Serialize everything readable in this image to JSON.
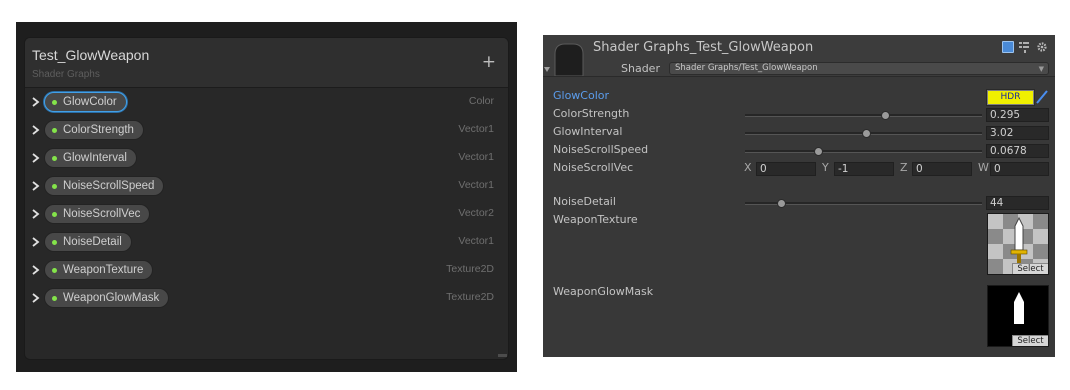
{
  "blackboard": {
    "title": "Test_GlowWeapon",
    "subtitle": "Shader Graphs",
    "add_label": "+",
    "properties": [
      {
        "name": "GlowColor",
        "type": "Color",
        "selected": true
      },
      {
        "name": "ColorStrength",
        "type": "Vector1"
      },
      {
        "name": "GlowInterval",
        "type": "Vector1"
      },
      {
        "name": "NoiseScrollSpeed",
        "type": "Vector1"
      },
      {
        "name": "NoiseScrollVec",
        "type": "Vector2"
      },
      {
        "name": "NoiseDetail",
        "type": "Vector1"
      },
      {
        "name": "WeaponTexture",
        "type": "Texture2D"
      },
      {
        "name": "WeaponGlowMask",
        "type": "Texture2D"
      }
    ],
    "colors": {
      "exposed_dot": "#84e44a",
      "selection": "#44a0e6"
    }
  },
  "inspector": {
    "title": "Shader Graphs_Test_GlowWeapon",
    "shader_label": "Shader",
    "shader_value": "Shader Graphs/Test_GlowWeapon",
    "header_icons": [
      "help-book-icon",
      "layout-icon",
      "gear-icon"
    ],
    "glow_color": {
      "label": "GlowColor",
      "swatch": "#f0f000",
      "badge": "HDR"
    },
    "color_strength": {
      "label": "ColorStrength",
      "value": "0.295",
      "slider": 0.59
    },
    "glow_interval": {
      "label": "GlowInterval",
      "value": "3.02",
      "slider": 0.51
    },
    "noise_scroll_speed": {
      "label": "NoiseScrollSpeed",
      "value": "0.0678",
      "slider": 0.31
    },
    "noise_scroll_vec": {
      "label": "NoiseScrollVec",
      "x_label": "X",
      "x": "0",
      "y_label": "Y",
      "y": "-1",
      "z_label": "Z",
      "z": "0",
      "w_label": "W",
      "w": "0"
    },
    "noise_detail": {
      "label": "NoiseDetail",
      "value": "44",
      "slider": 0.15
    },
    "weapon_texture": {
      "label": "WeaponTexture",
      "select": "Select"
    },
    "weapon_glow_mask": {
      "label": "WeaponGlowMask",
      "select": "Select"
    }
  }
}
